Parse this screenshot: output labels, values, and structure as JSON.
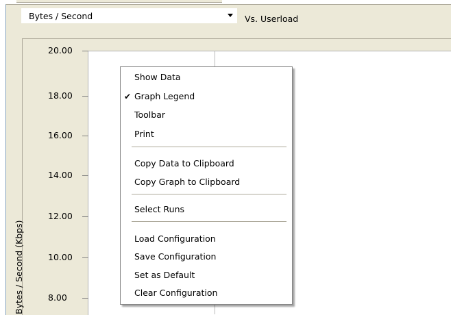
{
  "toolbar": {
    "metric_select_value": "Bytes / Second",
    "vs_label": "Vs. Userload"
  },
  "chart": {
    "y_axis_title": "Bytes / Second (Kbps)",
    "y_ticks": [
      "20.00",
      "18.00",
      "16.00",
      "14.00",
      "12.00",
      "10.00",
      "8.00"
    ]
  },
  "context_menu": {
    "items": [
      {
        "label": "Show Data",
        "checked": false
      },
      {
        "label": "Graph Legend",
        "checked": true
      },
      {
        "label": "Toolbar",
        "checked": false
      },
      {
        "label": "Print",
        "checked": false
      },
      {
        "label": "Copy Data to Clipboard",
        "checked": false
      },
      {
        "label": "Copy Graph to Clipboard",
        "checked": false
      },
      {
        "label": "Select Runs",
        "checked": false
      },
      {
        "label": "Load Configuration",
        "checked": false
      },
      {
        "label": "Save Configuration",
        "checked": false
      },
      {
        "label": "Set as Default",
        "checked": false
      },
      {
        "label": "Clear Configuration",
        "checked": false
      }
    ],
    "check_glyph": "✔"
  }
}
